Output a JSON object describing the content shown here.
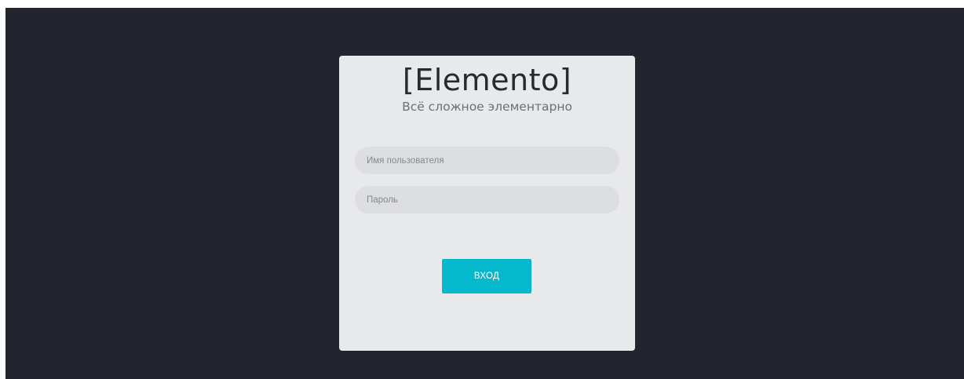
{
  "login": {
    "title": "[Elemento]",
    "tagline": "Всё сложное элементарно",
    "username_placeholder": "Имя пользователя",
    "password_placeholder": "Пароль",
    "submit_label": "ВХОД"
  },
  "colors": {
    "background": "#22252d",
    "card": "#e8e9ea",
    "field": "#dddee0",
    "accent": "#05b8cc"
  }
}
